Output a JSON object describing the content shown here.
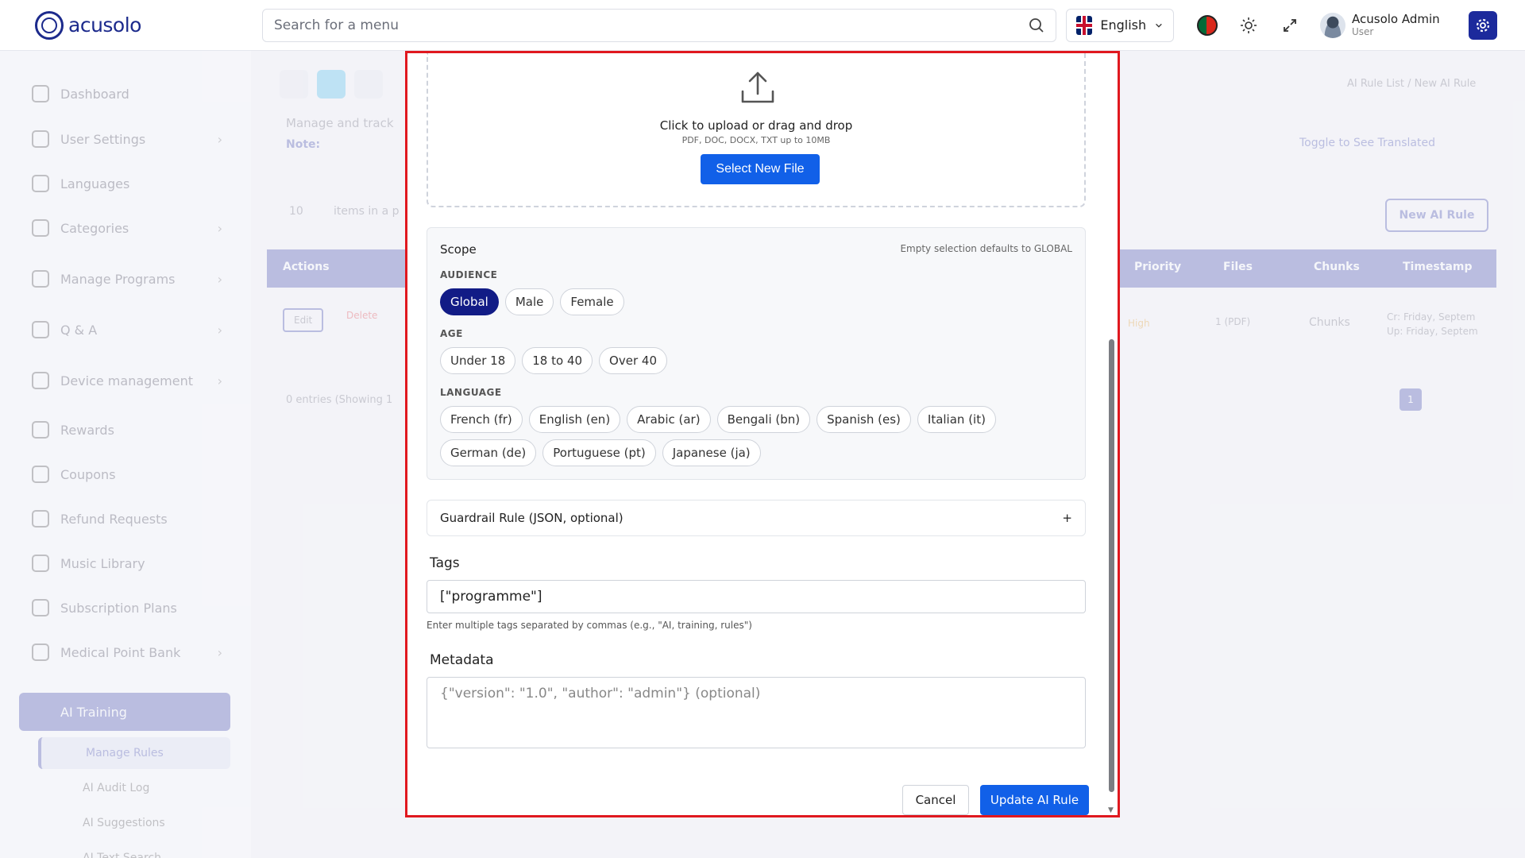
{
  "header": {
    "logo_text": "acusolo",
    "search_placeholder": "Search for a menu",
    "language": "English",
    "user_name": "Acusolo Admin",
    "user_role": "User"
  },
  "sidebar": {
    "items": [
      {
        "label": "Dashboard"
      },
      {
        "label": "User Settings"
      },
      {
        "label": "Languages"
      },
      {
        "label": "Categories"
      },
      {
        "label": "Manage Programs"
      },
      {
        "label": "Q & A"
      },
      {
        "label": "Device management"
      },
      {
        "label": "Rewards"
      },
      {
        "label": "Coupons"
      },
      {
        "label": "Refund Requests"
      },
      {
        "label": "Music Library"
      },
      {
        "label": "Subscription Plans"
      },
      {
        "label": "Medical Point Bank"
      }
    ],
    "active_section": "AI Training",
    "sub_items": [
      {
        "label": "Manage Rules"
      },
      {
        "label": "AI Audit Log"
      },
      {
        "label": "AI Suggestions"
      },
      {
        "label": "AI Text Search"
      }
    ]
  },
  "background": {
    "breadcrumb": "AI Rule List  /  New AI Rule",
    "description": "Manage and track",
    "note": "Note:",
    "toggle_label": "Toggle to See Translated",
    "page_size": "10",
    "items_label": "items in a p",
    "new_rule_button": "New AI Rule",
    "columns": [
      "Actions",
      "Priority",
      "Files",
      "Chunks",
      "Timestamp"
    ],
    "row": {
      "edit": "Edit",
      "delete": "Delete",
      "priority": "High",
      "files": "1 (PDF)",
      "chunks": "Chunks",
      "cr": "Cr:",
      "up": "Up:",
      "ts": "Friday, Septem"
    },
    "entries": "0 entries (Showing 1",
    "page": "1"
  },
  "modal": {
    "upload": {
      "title": "Click to upload or drag and drop",
      "subtitle": "PDF, DOC, DOCX, TXT up to 10MB",
      "button": "Select New File"
    },
    "scope": {
      "title": "Scope",
      "hint": "Empty selection defaults to GLOBAL",
      "audience_label": "AUDIENCE",
      "audience": [
        {
          "label": "Global",
          "selected": true
        },
        {
          "label": "Male",
          "selected": false
        },
        {
          "label": "Female",
          "selected": false
        }
      ],
      "age_label": "AGE",
      "age": [
        "Under 18",
        "18 to 40",
        "Over 40"
      ],
      "language_label": "LANGUAGE",
      "languages": [
        "French (fr)",
        "English (en)",
        "Arabic (ar)",
        "Bengali (bn)",
        "Spanish (es)",
        "Italian (it)",
        "German (de)",
        "Portuguese (pt)",
        "Japanese (ja)"
      ]
    },
    "guardrail": {
      "label": "Guardrail Rule (JSON, optional)",
      "toggle": "+"
    },
    "tags": {
      "label": "Tags",
      "value": "[\"programme\"]",
      "hint": "Enter multiple tags separated by commas (e.g., \"AI, training, rules\")"
    },
    "metadata": {
      "label": "Metadata",
      "placeholder": "{\"version\": \"1.0\", \"author\": \"admin\"} (optional)"
    },
    "cancel": "Cancel",
    "submit": "Update AI Rule"
  },
  "colors": {
    "primary": "#1160e8",
    "brand": "#1c2a9c",
    "selected_chip": "#121c86",
    "highlight_border": "#e0181f"
  }
}
